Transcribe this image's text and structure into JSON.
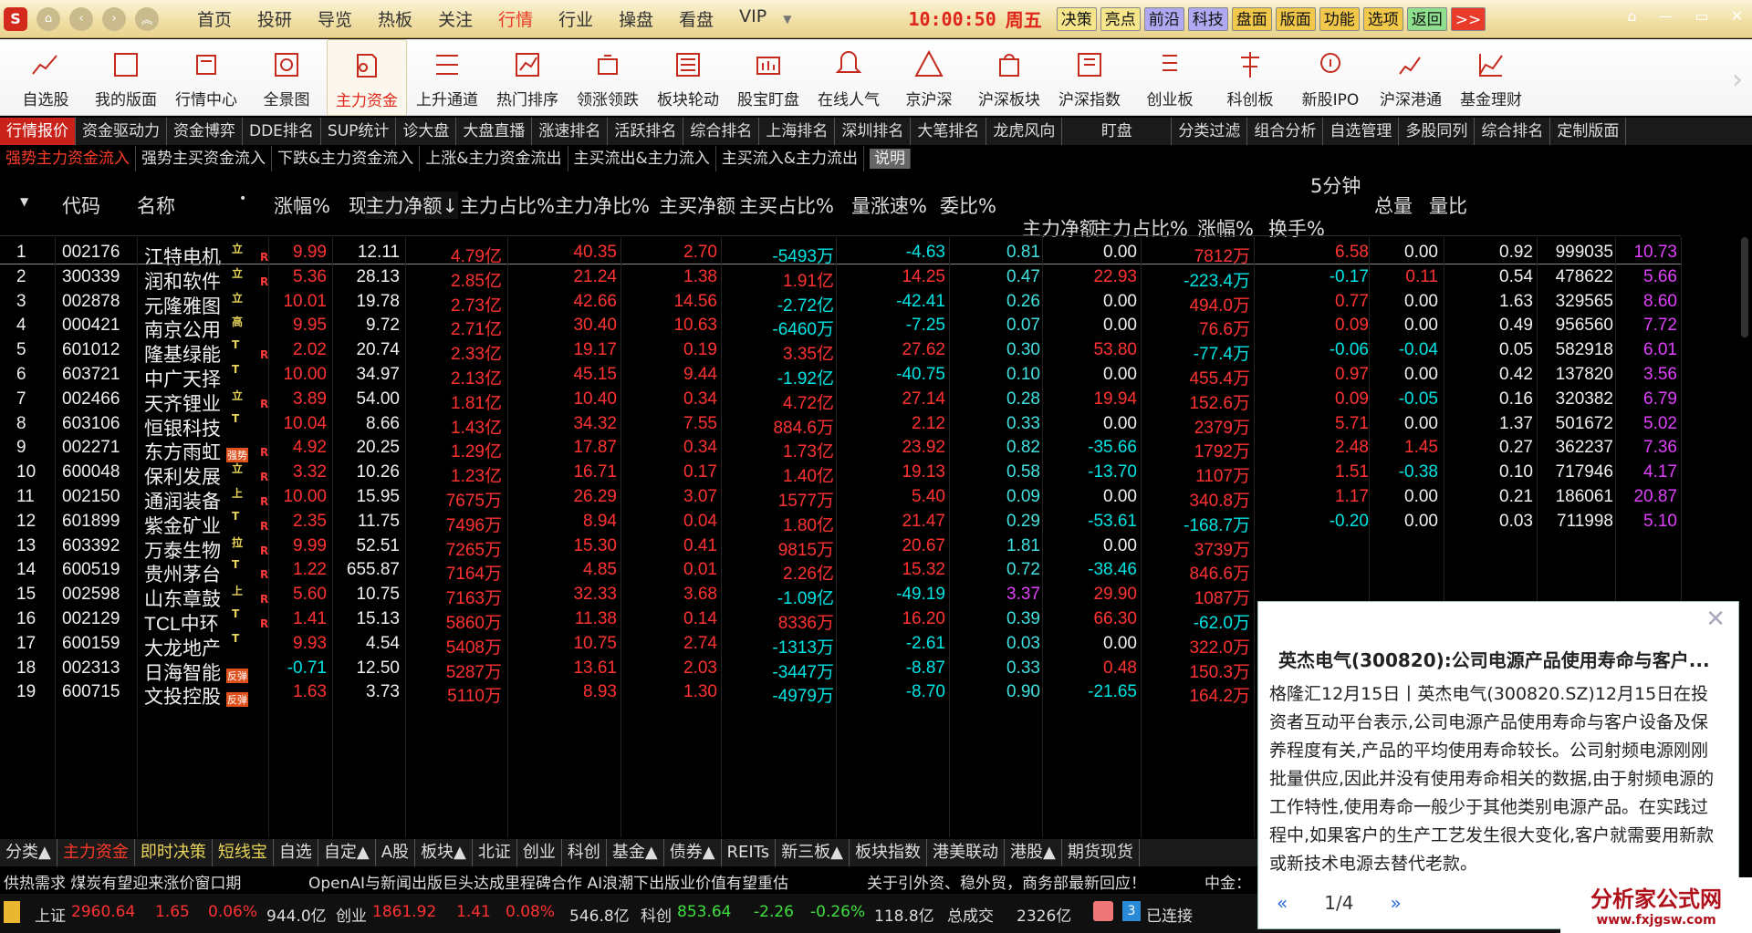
{
  "title_bar": {
    "logo": "S",
    "menu": [
      "首页",
      "投研",
      "导览",
      "热板",
      "关注",
      "行情",
      "行业",
      "操盘",
      "看盘",
      "VIP"
    ],
    "active_menu": "行情",
    "clock": "10:00:50",
    "weekday": "周五",
    "quick_buttons": [
      "决策",
      "亮点",
      "前沿",
      "科技",
      "盘面",
      "版面",
      "功能",
      "选项",
      "返回",
      ">>"
    ]
  },
  "toolbar": {
    "items": [
      "自选股",
      "我的版面",
      "行情中心",
      "全景图",
      "主力资金",
      "上升通道",
      "热门排序",
      "领涨领跌",
      "板块轮动",
      "股宝盯盘",
      "在线人气",
      "京沪深",
      "沪深板块",
      "沪深指数",
      "创业板",
      "科创板",
      "新股IPO",
      "沪深港通",
      "基金理财"
    ],
    "active": "主力资金"
  },
  "tabs_row1": {
    "items": [
      "行情报价",
      "资金驱动力",
      "资金博弈",
      "DDE排名",
      "SUP统计",
      "诊大盘",
      "大盘直播",
      "涨速排名",
      "活跃排名",
      "综合排名",
      "上海排名",
      "深圳排名",
      "大笔排名",
      "龙虎风向",
      "盯盘",
      "分类过滤",
      "组合分析",
      "自选管理",
      "多股同列",
      "综合排名",
      "定制版面"
    ],
    "active": "行情报价"
  },
  "tabs_row2": {
    "items": [
      "强势主力资金流入",
      "强势主买资金流入",
      "下跌&主力资金流入",
      "上涨&主力资金流出",
      "主买流出&主力流入",
      "主买流入&主力流出"
    ],
    "active": "强势主力资金流入",
    "explain": "说明"
  },
  "table": {
    "group_header": "5分钟",
    "columns": [
      "代码",
      "名称",
      "涨幅%",
      "现价",
      "主力净额↓",
      "主力占比%",
      "主力净比%",
      "主买净额",
      "主买占比%",
      "量涨速%",
      "委比%",
      "主力净额",
      "主力占比%",
      "涨幅%",
      "换手%",
      "总量",
      "量比"
    ],
    "rows": [
      [
        "1",
        "002176",
        "江特电机",
        "立",
        "R",
        "9.99",
        "12.11",
        "4.79亿",
        "40.35",
        "2.70",
        "-5493万",
        "-4.63",
        "0.81",
        "0.00",
        "7812万",
        "6.58",
        "0.00",
        "0.92",
        "999035",
        "10.73"
      ],
      [
        "2",
        "300339",
        "润和软件",
        "立",
        "R",
        "5.36",
        "28.13",
        "2.85亿",
        "21.24",
        "1.38",
        "1.91亿",
        "14.25",
        "0.47",
        "22.93",
        "-223.4万",
        "-0.17",
        "0.11",
        "0.54",
        "478622",
        "5.66"
      ],
      [
        "3",
        "002878",
        "元隆雅图",
        "立",
        "",
        "10.01",
        "19.78",
        "2.73亿",
        "42.66",
        "14.56",
        "-2.72亿",
        "-42.41",
        "0.26",
        "0.00",
        "494.0万",
        "0.77",
        "0.00",
        "1.63",
        "329565",
        "8.60"
      ],
      [
        "4",
        "000421",
        "南京公用",
        "高",
        "",
        "9.95",
        "9.72",
        "2.71亿",
        "30.40",
        "10.63",
        "-6460万",
        "-7.25",
        "0.07",
        "0.00",
        "76.6万",
        "0.09",
        "0.00",
        "0.49",
        "956560",
        "7.72"
      ],
      [
        "5",
        "601012",
        "隆基绿能",
        "T",
        "R",
        "2.02",
        "20.74",
        "2.33亿",
        "19.17",
        "0.19",
        "3.35亿",
        "27.62",
        "0.30",
        "53.80",
        "-77.4万",
        "-0.06",
        "-0.04",
        "0.05",
        "582918",
        "6.01"
      ],
      [
        "6",
        "603721",
        "中广天择",
        "T",
        "",
        "10.00",
        "34.97",
        "2.13亿",
        "45.15",
        "9.44",
        "-1.92亿",
        "-40.75",
        "0.10",
        "0.00",
        "455.4万",
        "0.97",
        "0.00",
        "0.42",
        "137820",
        "3.56"
      ],
      [
        "7",
        "002466",
        "天齐锂业",
        "立",
        "R",
        "3.89",
        "54.00",
        "1.81亿",
        "10.40",
        "0.34",
        "4.72亿",
        "27.14",
        "0.28",
        "19.94",
        "152.6万",
        "0.09",
        "-0.05",
        "0.16",
        "320382",
        "6.79"
      ],
      [
        "8",
        "603106",
        "恒银科技",
        "T",
        "",
        "10.04",
        "8.66",
        "1.43亿",
        "34.32",
        "7.55",
        "884.6万",
        "2.12",
        "0.33",
        "0.00",
        "2379万",
        "5.71",
        "0.00",
        "1.37",
        "501672",
        "5.02"
      ],
      [
        "9",
        "002271",
        "东方雨虹",
        "强势",
        "R",
        "4.92",
        "20.25",
        "1.29亿",
        "17.87",
        "0.34",
        "1.73亿",
        "23.92",
        "0.82",
        "-35.66",
        "1792万",
        "2.48",
        "1.45",
        "0.27",
        "362237",
        "7.36"
      ],
      [
        "10",
        "600048",
        "保利发展",
        "立",
        "R",
        "3.32",
        "10.26",
        "1.23亿",
        "16.71",
        "0.17",
        "1.40亿",
        "19.13",
        "0.58",
        "-13.70",
        "1107万",
        "1.51",
        "-0.38",
        "0.10",
        "717946",
        "4.17"
      ],
      [
        "11",
        "002150",
        "通润装备",
        "上",
        "R",
        "10.00",
        "15.95",
        "7675万",
        "26.29",
        "3.07",
        "1577万",
        "5.40",
        "0.09",
        "0.00",
        "340.8万",
        "1.17",
        "0.00",
        "0.21",
        "186061",
        "20.87"
      ],
      [
        "12",
        "601899",
        "紫金矿业",
        "T",
        "R",
        "2.35",
        "11.75",
        "7496万",
        "8.94",
        "0.04",
        "1.80亿",
        "21.47",
        "0.29",
        "-53.61",
        "-168.7万",
        "-0.20",
        "0.00",
        "0.03",
        "711998",
        "5.10"
      ],
      [
        "13",
        "603392",
        "万泰生物",
        "拉",
        "R",
        "9.99",
        "52.51",
        "7265万",
        "15.30",
        "0.41",
        "9815万",
        "20.67",
        "1.81",
        "0.00",
        "3739万",
        "",
        "",
        "",
        "",
        ""
      ],
      [
        "14",
        "600519",
        "贵州茅台",
        "T",
        "R",
        "1.22",
        "655.87",
        "7164万",
        "4.85",
        "0.01",
        "2.26亿",
        "15.32",
        "0.72",
        "-38.46",
        "846.6万",
        "",
        "",
        "",
        "",
        ""
      ],
      [
        "15",
        "002598",
        "山东章鼓",
        "上",
        "R",
        "5.60",
        "10.75",
        "7163万",
        "32.33",
        "3.68",
        "-1.09亿",
        "-49.19",
        "3.37",
        "29.90",
        "1087万",
        "",
        "",
        "",
        "",
        ""
      ],
      [
        "16",
        "002129",
        "TCL中环",
        "T",
        "R",
        "1.41",
        "15.13",
        "5860万",
        "11.38",
        "0.14",
        "8336万",
        "16.20",
        "0.39",
        "66.30",
        "-62.0万",
        "",
        "",
        "",
        "",
        ""
      ],
      [
        "17",
        "600159",
        "大龙地产",
        "T",
        "",
        "9.93",
        "4.54",
        "5408万",
        "10.75",
        "2.74",
        "-1313万",
        "-2.61",
        "0.03",
        "0.00",
        "322.0万",
        "",
        "",
        "",
        "",
        ""
      ],
      [
        "18",
        "002313",
        "日海智能",
        "反弹",
        "",
        "-0.71",
        "12.50",
        "5287万",
        "13.61",
        "2.03",
        "-3447万",
        "-8.87",
        "0.33",
        "0.48",
        "150.3万",
        "",
        "",
        "",
        "",
        ""
      ],
      [
        "19",
        "600715",
        "文投控股",
        "反弹",
        "",
        "1.63",
        "3.73",
        "5110万",
        "8.93",
        "1.30",
        "-4979万",
        "-8.70",
        "0.90",
        "-21.65",
        "164.2万",
        "",
        "",
        "",
        "",
        ""
      ]
    ]
  },
  "bottom_tabs": {
    "items": [
      "分类▲",
      "主力资金",
      "即时决策",
      "短线宝",
      "自选",
      "自定▲",
      "A股",
      "板块▲",
      "北证",
      "创业",
      "科创",
      "基金▲",
      "债券▲",
      "REITs",
      "新三板▲",
      "板块指数",
      "港美联动",
      "港股▲",
      "期货现货"
    ],
    "active": "主力资金",
    "yellow": [
      "即时决策",
      "短线宝"
    ]
  },
  "ticker": {
    "items": [
      "供热需求 煤炭有望迎来涨价窗口期",
      "OpenAI与新闻出版巨头达成里程碑合作 AI浪潮下出版业价值有望重估",
      "关于引外资、稳外贸，商务部最新回应！",
      "中金："
    ]
  },
  "status": {
    "sh_label": "上证",
    "sh_value": "2960.64",
    "sh_chg": "1.65",
    "sh_pct": "0.06%",
    "sh_amt": "944.0亿",
    "cy_label": "创业",
    "cy_value": "1861.92",
    "cy_chg": "1.41",
    "cy_pct": "0.08%",
    "cy_amt": "546.8亿",
    "kc_label": "科创",
    "kc_value": "853.64",
    "kc_chg": "-2.26",
    "kc_pct": "-0.26%",
    "kc_amt": "118.8亿",
    "total_label": "总成交",
    "total_value": "2326亿",
    "conn_num": "3",
    "conn_label": "已连接"
  },
  "popup": {
    "title": "英杰电气(300820):公司电源产品使用寿命与客户...",
    "body": "格隆汇12月15日丨英杰电气(300820.SZ)12月15日在投资者互动平台表示,公司电源产品使用寿命与客户设备及保养程度有关,产品的平均使用寿命较长。公司射频电源刚刚批量供应,因此并没有使用寿命相关的数据,由于射频电源的工作特性,使用寿命一般少于其他类别电源产品。在实践过程中,如果客户的生产工艺发生很大变化,客户就需要用新款或新技术电源去替代老款。",
    "page": "1/4"
  },
  "watermark": {
    "name": "分析家公式网",
    "url": "www.fxjgsw.com"
  },
  "colors": {
    "up": "#ff3232",
    "down": "#00e4e4",
    "accent": "#c8221a",
    "gold": "#e9d45a"
  }
}
